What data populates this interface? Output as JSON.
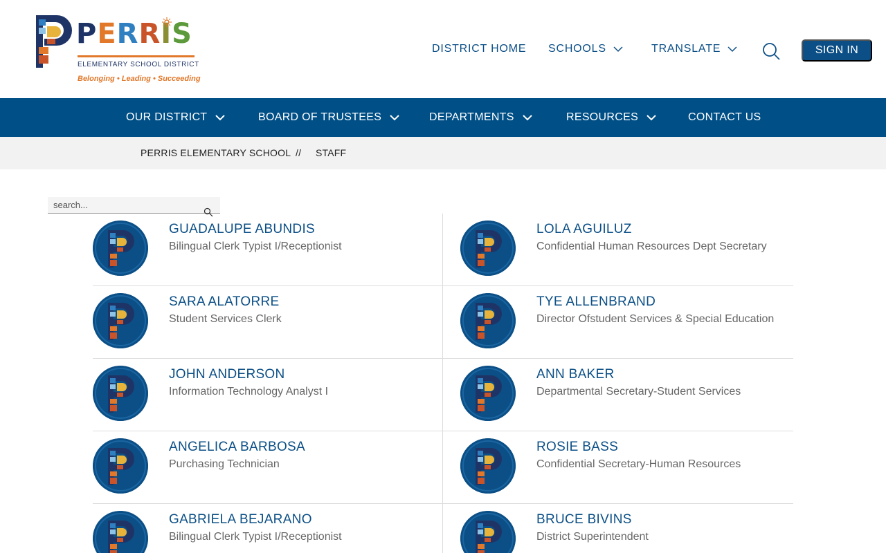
{
  "logo": {
    "wordmark": [
      "P",
      "E",
      "R",
      "R",
      "I",
      "S"
    ],
    "subtitle": "ELEMENTARY SCHOOL DISTRICT",
    "tagline": "Belonging • Leading • Succeeding"
  },
  "topnav": {
    "district_home": "DISTRICT HOME",
    "schools": "SCHOOLS",
    "translate": "TRANSLATE",
    "sign_in": "SIGN IN"
  },
  "mainnav": {
    "items": [
      "OUR DISTRICT",
      "BOARD OF TRUSTEES",
      "DEPARTMENTS",
      "RESOURCES",
      "CONTACT US"
    ]
  },
  "breadcrumb": {
    "home": "PERRIS ELEMENTARY SCHOOL",
    "separator": "//",
    "current": "STAFF"
  },
  "search": {
    "placeholder": "search..."
  },
  "staff": [
    {
      "name": "GUADALUPE ABUNDIS",
      "title": "Bilingual Clerk Typist I/Receptionist"
    },
    {
      "name": "LOLA AGUILUZ",
      "title": "Confidential Human Resources Dept Secretary"
    },
    {
      "name": "SARA ALATORRE",
      "title": "Student Services Clerk"
    },
    {
      "name": "TYE ALLENBRAND",
      "title": "Director Ofstudent Services & Special Education"
    },
    {
      "name": "JOHN ANDERSON",
      "title": "Information Technology Analyst I"
    },
    {
      "name": "ANN BAKER",
      "title": "Departmental Secretary-Student Services"
    },
    {
      "name": "ANGELICA BARBOSA",
      "title": "Purchasing Technician"
    },
    {
      "name": "ROSIE BASS",
      "title": "Confidential Secretary-Human Resources"
    },
    {
      "name": "GABRIELA BEJARANO",
      "title": "Bilingual Clerk Typist I/Receptionist"
    },
    {
      "name": "BRUCE BIVINS",
      "title": "District Superintendent"
    }
  ],
  "colors": {
    "brand_blue": "#0b4f86",
    "nav_blue": "#004f86",
    "orange": "#e1782a",
    "breadcrumb_bg": "#f2f2f2"
  }
}
